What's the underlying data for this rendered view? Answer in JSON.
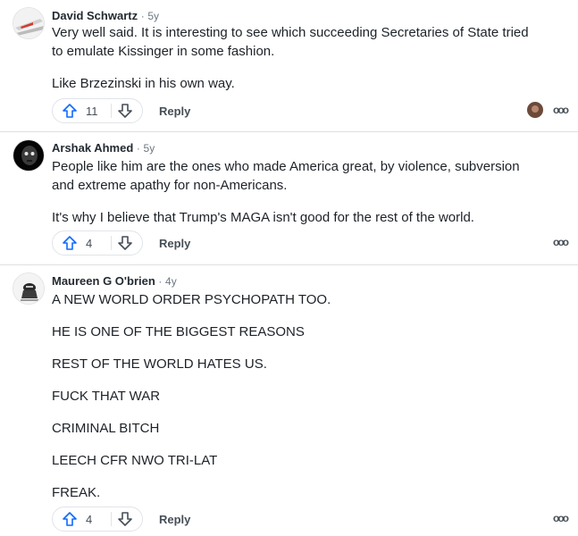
{
  "comments": [
    {
      "author": "David Schwartz",
      "time": "5y",
      "paragraphs": [
        "Very well said. It is interesting to see which succeeding Secretaries of State tried to emulate Kissinger in some fashion.",
        "Like Brzezinski in his own way."
      ],
      "upvotes": "11",
      "reply_label": "Reply",
      "more_label": "ooo"
    },
    {
      "author": "Arshak Ahmed",
      "time": "5y",
      "paragraphs": [
        "People like him are the ones who made America great, by violence, subversion and extreme apathy for non-Americans.",
        "It's why I believe that Trump's MAGA isn't good for the rest of the world."
      ],
      "upvotes": "4",
      "reply_label": "Reply",
      "more_label": "ooo"
    },
    {
      "author": "Maureen G O'brien",
      "time": "4y",
      "paragraphs": [
        "A NEW WORLD ORDER PSYCHOPATH TOO.",
        "HE IS ONE OF THE BIGGEST REASONS",
        "REST OF THE WORLD HATES US.",
        "FUCK THAT WAR",
        "CRIMINAL BITCH",
        "LEECH CFR NWO TRI-LAT",
        "FREAK."
      ],
      "upvotes": "4",
      "reply_label": "Reply",
      "more_label": "ooo"
    }
  ],
  "separator": "·",
  "colors": {
    "vote_icon": "#0f69ff",
    "divider": "#dee0e1"
  }
}
